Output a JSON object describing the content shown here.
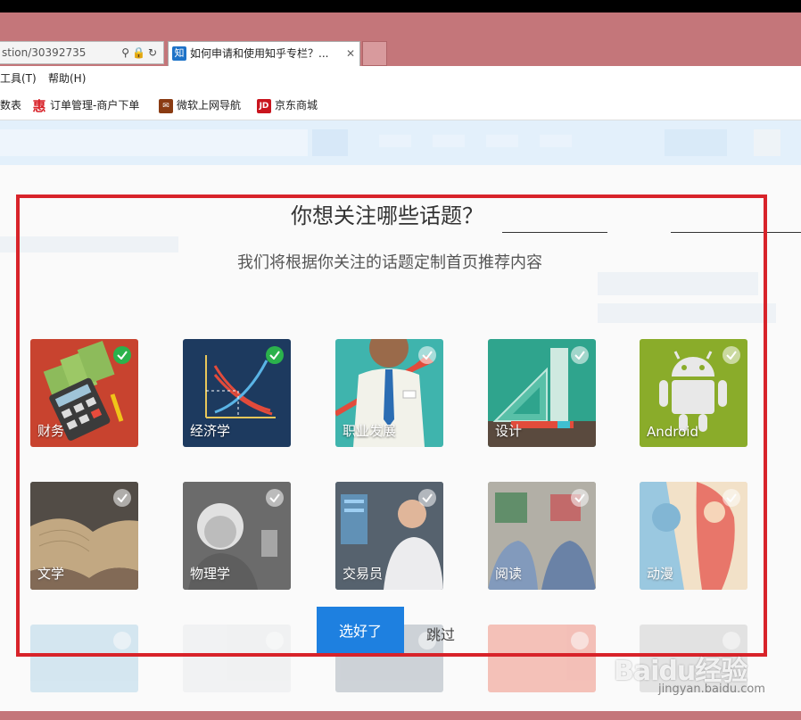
{
  "browser": {
    "address_text": "stion/30392735",
    "tab_title": "如何申请和使用知乎专栏？...",
    "tab_favicon": "知",
    "tab_close": "✕",
    "menu": [
      "工具(T)",
      "帮助(H)"
    ],
    "favorites": [
      {
        "label": "数表",
        "icon": "table-icon"
      },
      {
        "label": "订单管理-商户下单",
        "icon": "hui-icon",
        "badge": "惠"
      },
      {
        "label": "微软上网导航",
        "icon": "mail-icon"
      },
      {
        "label": "京东商城",
        "icon": "jd-icon",
        "badge": "JD"
      }
    ]
  },
  "modal": {
    "title": "你想关注哪些话题？",
    "subtitle": "我们将根据你关注的话题定制首页推荐内容",
    "topics": [
      {
        "label": "财务",
        "checked": true
      },
      {
        "label": "经济学",
        "checked": true
      },
      {
        "label": "职业发展",
        "checked": false
      },
      {
        "label": "设计",
        "checked": false
      },
      {
        "label": "Android",
        "checked": false
      },
      {
        "label": "文学",
        "checked": false
      },
      {
        "label": "物理学",
        "checked": false
      },
      {
        "label": "交易员",
        "checked": false
      },
      {
        "label": "阅读",
        "checked": false
      },
      {
        "label": "动漫",
        "checked": false
      }
    ],
    "done_button": "选好了",
    "skip_link": "跳过"
  },
  "watermark": {
    "brand": "Baidu经验",
    "url": "jingyan.baidu.com"
  },
  "colors": {
    "frame": "#d8232a",
    "primary": "#1e80e0",
    "check_on": "#2bb24c",
    "chrome": "#c4767a"
  }
}
